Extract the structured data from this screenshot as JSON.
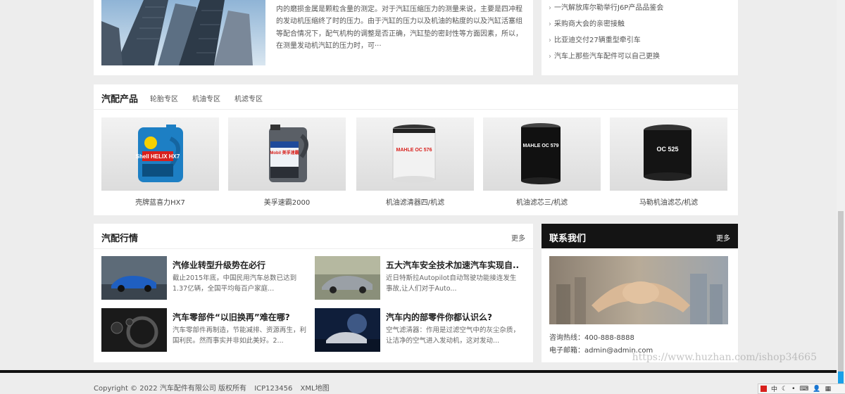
{
  "top_article": {
    "text": "…造成发动机，近一步会导致汽缸内部磨损变大，缩短发动机使用寿命，曲轴箱内的磨损金属是颗粒含量的测定。对于汽缸压缩压力的测量来说，主要是四冲程的发动机压缩终了时的压力。由于汽缸的压力以及机油的粘度的以及汽缸活塞组等配合情况下，配气机构的调整是否正确，汽缸垫的密封性等方面因素，所以，在测量发动机汽缸的压力时，可···"
  },
  "top_news": [
    "一汽解放库尔勒举行J6P产品品鉴会",
    "采购商大会的亲密接触",
    "比亚迪交付27辆重型牵引车",
    "汽车上那些汽车配件可以自己更换"
  ],
  "products": {
    "title": "汽配产品",
    "tabs": [
      "轮胎专区",
      "机油专区",
      "机滤专区"
    ],
    "items": [
      {
        "name": "壳牌蓝喜力HX7",
        "label": "Shell HELIX HX7"
      },
      {
        "name": "美孚速霸2000",
        "label": "Mobil 美孚速霸"
      },
      {
        "name": "机油滤清器四/机滤",
        "label": "MAHLE OC 576"
      },
      {
        "name": "机油滤芯三/机滤",
        "label": "MAHLE OC 579"
      },
      {
        "name": "马勒机油滤芯/机滤",
        "label": "OC 525"
      }
    ]
  },
  "market": {
    "title": "汽配行情",
    "more": "更多",
    "items": [
      {
        "title": "汽修业转型升级势在必行",
        "desc": "截止2015年底，中国民用汽车总数已达到1.37亿辆，全国平均每百户家庭..."
      },
      {
        "title": "五大汽车安全技术加速汽车实现自...",
        "desc": "近日特斯拉Autopilot自动驾驶功能接连发生事故,让人们对于Auto..."
      },
      {
        "title": "汽车零部件“以旧换再”难在哪?",
        "desc": "汽车零部件再制造，节能减排、资源再生，利国利民。然而事实并非如此美好。2..."
      },
      {
        "title": "汽车内的部零件你都认识么?",
        "desc": "空气滤清器：作用是过滤空气中的灰尘杂质，让洁净的空气进入发动机，这对发动..."
      }
    ]
  },
  "contact": {
    "title": "联系我们",
    "more": "更多",
    "hotline": "咨询热线：400-888-8888",
    "email": "电子邮箱：admin@admin.com"
  },
  "footer": {
    "copyright": "Copyright © 2022 汽车配件有限公司 版权所有",
    "icp": "ICP123456",
    "sitemap": "XML地图"
  },
  "watermark": "https://www.huzhan.com/ishop34665",
  "ime": {
    "lang": "中"
  }
}
